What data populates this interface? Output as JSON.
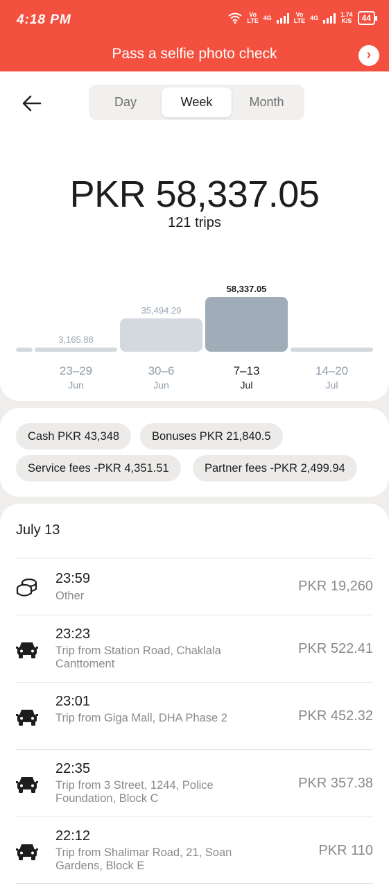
{
  "status": {
    "time": "4:18 PM",
    "volte1": "Vo",
    "lte1": "LTE",
    "net1": "4G",
    "volte2": "Vo",
    "lte2": "LTE",
    "net2": "4G",
    "speed": "1.74",
    "speed_unit": "K/S",
    "battery": "44"
  },
  "banner": {
    "text": "Pass a selfie photo check",
    "arrow": "›"
  },
  "tabs": [
    "Day",
    "Week",
    "Month"
  ],
  "active_tab": "Week",
  "summary": {
    "total": "PKR 58,337.05",
    "trips": "121 trips"
  },
  "chart_data": {
    "type": "bar",
    "categories": [
      "23–29 Jun",
      "30–6 Jun",
      "7–13 Jul",
      "14–20 Jul"
    ],
    "range_labels": [
      "23–29",
      "30–6",
      "7–13",
      "14–20"
    ],
    "month_labels": [
      "Jun",
      "Jun",
      "Jul",
      "Jul"
    ],
    "values": [
      3165.88,
      35494.29,
      58337.05,
      0
    ],
    "value_labels": [
      "3,165.88",
      "35,494.29",
      "58,337.05",
      ""
    ],
    "active_index": 2,
    "colors": {
      "inactive": "#d3d9df",
      "active": "#a0adb9"
    }
  },
  "breakdown": {
    "cash": "Cash PKR 43,348",
    "bonuses": "Bonuses PKR 21,840.5",
    "service_fees": "Service fees -PKR 4,351.51",
    "partner_fees": "Partner fees -PKR 2,499.94"
  },
  "list": {
    "date": "July 13",
    "items": [
      {
        "time": "23:59",
        "desc": "Other",
        "amount": "PKR 19,260",
        "icon": "coins-icon"
      },
      {
        "time": "23:23",
        "desc": "Trip from Station Road, Chaklala Canttoment",
        "amount": "PKR 522.41",
        "icon": "car-icon"
      },
      {
        "time": "23:01",
        "desc": "Trip from Giga Mall, DHA Phase 2",
        "amount": "PKR 452.32",
        "icon": "car-icon"
      },
      {
        "time": "22:35",
        "desc": "Trip from 3 Street, 1244, Police Foundation, Block C",
        "amount": "PKR 357.38",
        "icon": "car-icon"
      },
      {
        "time": "22:12",
        "desc": "Trip from Shalimar Road, 21, Soan Gardens, Block E",
        "amount": "PKR 110",
        "icon": "car-icon"
      }
    ]
  },
  "colors": {
    "brand": "#f4503f"
  }
}
